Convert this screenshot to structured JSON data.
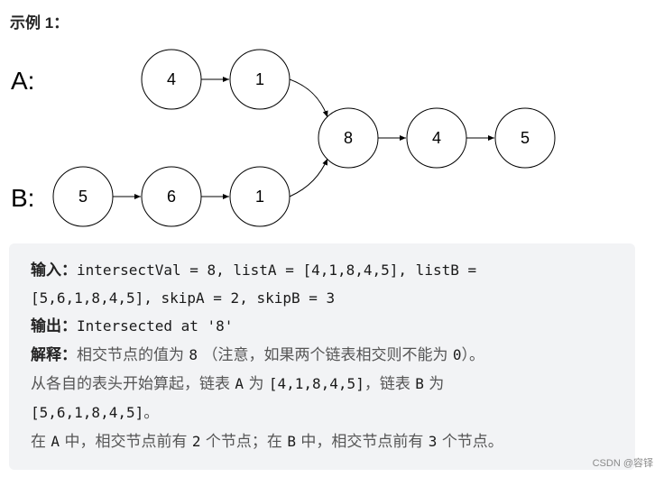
{
  "heading": "示例 1：",
  "diagram": {
    "list_a_label": "A:",
    "list_b_label": "B:",
    "list_a_nodes": [
      "4",
      "1"
    ],
    "list_b_nodes": [
      "5",
      "6",
      "1"
    ],
    "shared_nodes": [
      "8",
      "4",
      "5"
    ]
  },
  "example": {
    "input_label": "输入：",
    "input_line1": "intersectVal = 8, listA = [4,1,8,4,5], listB =",
    "input_line2": "[5,6,1,8,4,5], skipA = 2, skipB = 3",
    "output_label": "输出：",
    "output_value": "Intersected at '8'",
    "explain_label": "解释：",
    "explain_l1_a": "相交节点的值为",
    "explain_l1_val": "8",
    "explain_l1_b": "（注意，如果两个链表相交则不能为",
    "explain_l1_zero": "0",
    "explain_l1_c": "）。",
    "explain_l2_a": "从各自的表头开始算起，链表",
    "explain_l2_A": "A",
    "explain_l2_b": "为",
    "explain_l2_listA": "[4,1,8,4,5]",
    "explain_l2_c": "，链表",
    "explain_l2_B": "B",
    "explain_l2_d": "为",
    "explain_l3_listB": "[5,6,1,8,4,5]",
    "explain_l3_end": "。",
    "explain_l4_a": "在",
    "explain_l4_A": "A",
    "explain_l4_b": "中，相交节点前有",
    "explain_l4_n1": "2",
    "explain_l4_c": "个节点；在",
    "explain_l4_B": "B",
    "explain_l4_d": "中，相交节点前有",
    "explain_l4_n2": "3",
    "explain_l4_e": "个节点。"
  },
  "watermark": "CSDN @容铎"
}
